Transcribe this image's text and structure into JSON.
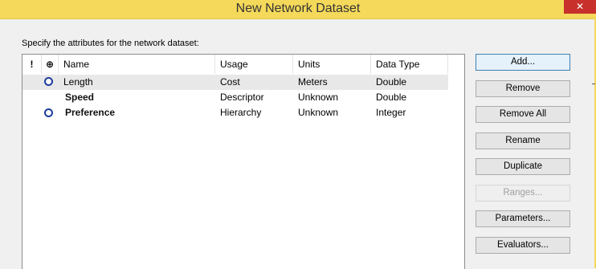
{
  "window": {
    "title": "New Network Dataset",
    "close_symbol": "✕"
  },
  "instruction": "Specify the attributes for the network dataset:",
  "table": {
    "headers": {
      "required_icon": "!",
      "default_icon": "⊕",
      "name": "Name",
      "usage": "Usage",
      "units": "Units",
      "data_type": "Data Type"
    },
    "rows": [
      {
        "name": "Length",
        "usage": "Cost",
        "units": "Meters",
        "data_type": "Double",
        "default": true,
        "selected": true
      },
      {
        "name": "Speed",
        "usage": "Descriptor",
        "units": "Unknown",
        "data_type": "Double",
        "default": false,
        "selected": false
      },
      {
        "name": "Preference",
        "usage": "Hierarchy",
        "units": "Unknown",
        "data_type": "Integer",
        "default": true,
        "selected": false
      }
    ]
  },
  "buttons": {
    "add": "Add...",
    "remove": "Remove",
    "remove_all": "Remove All",
    "rename": "Rename",
    "duplicate": "Duplicate",
    "ranges": "Ranges...",
    "parameters": "Parameters...",
    "evaluators": "Evaluators..."
  },
  "colors": {
    "titlebar": "#f5d95a",
    "close": "#c7302b",
    "selection": "#e8e8e8",
    "default_marker": "#1d3d9f"
  }
}
